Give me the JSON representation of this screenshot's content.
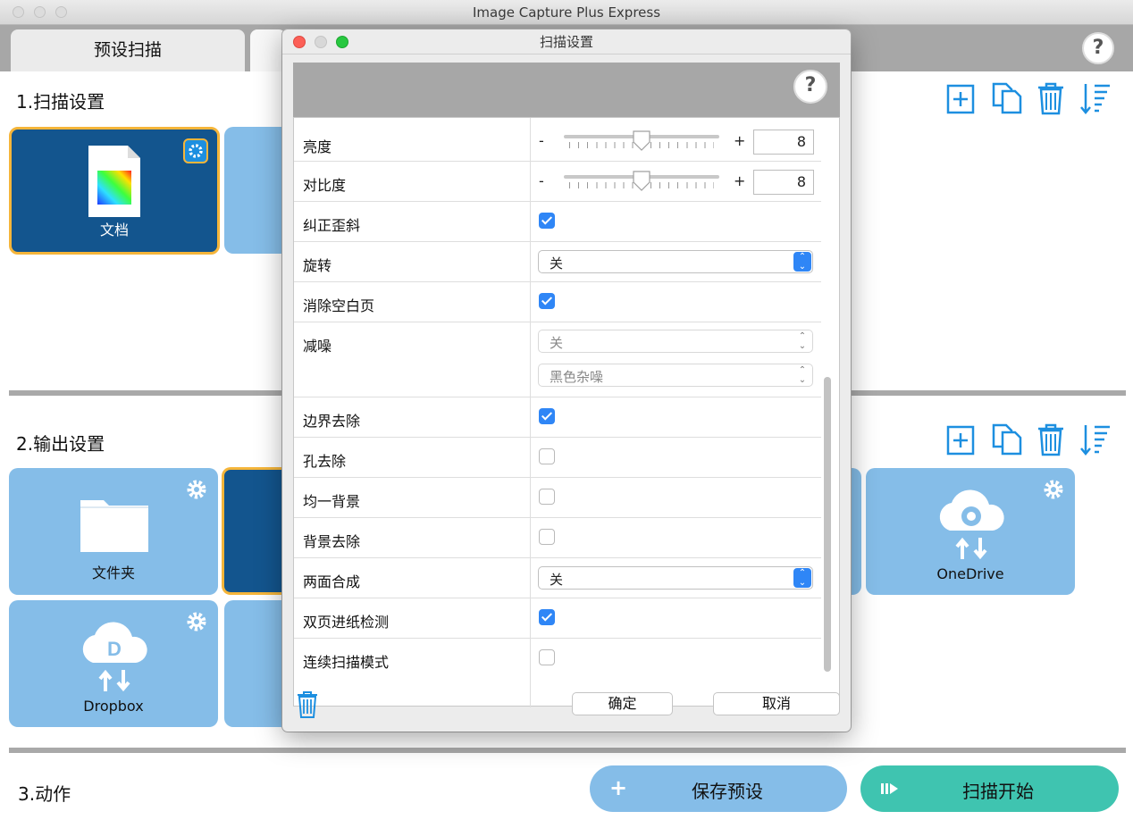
{
  "window": {
    "title": "Image Capture Plus Express"
  },
  "tabs": [
    {
      "label": "预设扫描"
    }
  ],
  "sections": {
    "scan": {
      "title": "1.扫描设置"
    },
    "output": {
      "title": "2.输出设置"
    },
    "action": {
      "title": "3.动作"
    }
  },
  "scan_cards": [
    {
      "label": "文档"
    }
  ],
  "output_cards": [
    {
      "label": "文件夹"
    },
    {
      "label": "OneDrive"
    },
    {
      "label": "Dropbox"
    }
  ],
  "actions": {
    "save_preset": "保存预设",
    "start_scan": "扫描开始"
  },
  "dialog": {
    "title": "扫描设置",
    "rows": {
      "brightness": {
        "label": "亮度",
        "minus": "-",
        "plus": "+",
        "value": "8",
        "level": 0.5
      },
      "contrast": {
        "label": "对比度",
        "minus": "-",
        "plus": "+",
        "value": "8",
        "level": 0.5
      },
      "deskew": {
        "label": "纠正歪斜",
        "checked": true
      },
      "rotate": {
        "label": "旋转",
        "value": "关"
      },
      "blank_page": {
        "label": "消除空白页",
        "checked": true
      },
      "noise": {
        "label": "减噪",
        "value1": "关",
        "value2": "黑色杂噪"
      },
      "border": {
        "label": "边界去除",
        "checked": true
      },
      "hole": {
        "label": "孔去除",
        "checked": false
      },
      "uniform_bg": {
        "label": "均一背景",
        "checked": false
      },
      "bg_remove": {
        "label": "背景去除",
        "checked": false
      },
      "duplex_merge": {
        "label": "两面合成",
        "value": "关"
      },
      "double_feed": {
        "label": "双页进纸检测",
        "checked": true
      },
      "continuous": {
        "label": "连续扫描模式",
        "checked": false
      }
    },
    "ok": "确定",
    "cancel": "取消"
  },
  "colors": {
    "card_light": "#85bde8",
    "card_dark": "#13558e",
    "selected_border": "#f5b53a",
    "icon_blue": "#1d8fe0",
    "save_button": "#85bde8",
    "start_button": "#3fc4b0",
    "checkbox_on": "#2f86f6"
  }
}
